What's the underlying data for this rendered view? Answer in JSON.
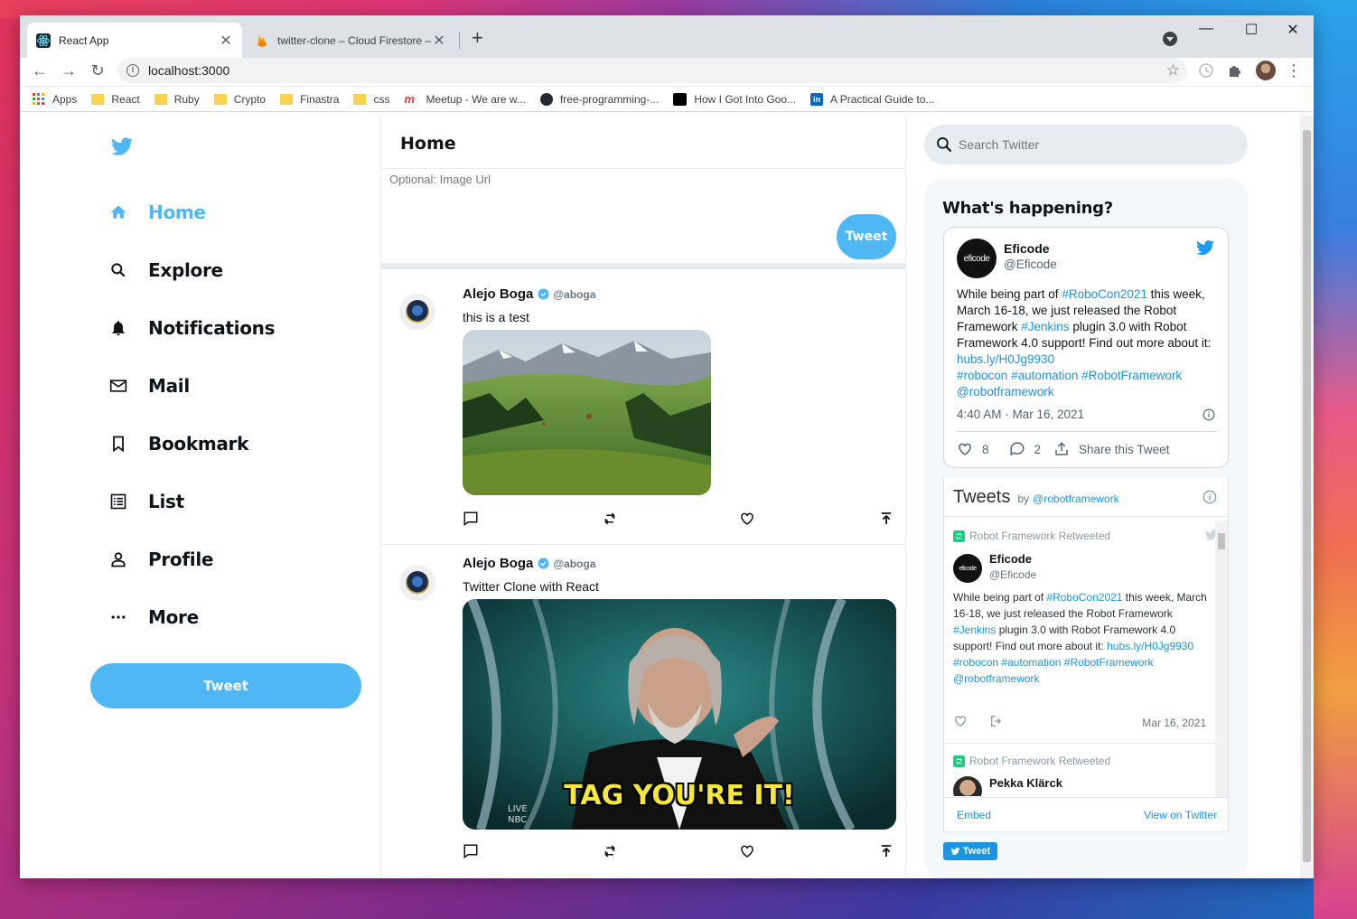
{
  "browser": {
    "tabs": [
      {
        "title": "React App",
        "active": true
      },
      {
        "title": "twitter-clone – Cloud Firestore – ",
        "active": false
      }
    ],
    "url": "localhost:3000",
    "bookmarks": [
      "Apps",
      "React",
      "Ruby",
      "Crypto",
      "Finastra",
      "css",
      "Meetup - We are w...",
      "free-programming-...",
      "How I Got Into Goo...",
      "A Practical Guide to..."
    ]
  },
  "sidebar": {
    "items": [
      {
        "label": "Home",
        "icon": "home-icon",
        "active": true
      },
      {
        "label": "Explore",
        "icon": "search-icon",
        "active": false
      },
      {
        "label": "Notifications",
        "icon": "bell-icon",
        "active": false
      },
      {
        "label": "Mail",
        "icon": "mail-icon",
        "active": false
      },
      {
        "label": "Bookmark",
        "icon": "bookmark-icon",
        "active": false
      },
      {
        "label": "List",
        "icon": "list-icon",
        "active": false
      },
      {
        "label": "Profile",
        "icon": "profile-icon",
        "active": false
      },
      {
        "label": "More",
        "icon": "more-icon",
        "active": false
      }
    ],
    "tweet_button": "Tweet"
  },
  "feed": {
    "title": "Home",
    "composer": {
      "image_placeholder": "Optional: Image Url",
      "tweet_button": "Tweet"
    },
    "posts": [
      {
        "name": "Alejo Boga",
        "handle": "@aboga",
        "text": "this is a test",
        "image": "mountain-landscape"
      },
      {
        "name": "Alejo Boga",
        "handle": "@aboga",
        "text": "Twitter Clone with React",
        "image": "gif",
        "image_caption": "TAG YOU'RE IT!",
        "watermark": "LIVE NBC"
      }
    ]
  },
  "widgets": {
    "search_placeholder": "Search Twitter",
    "title": "What's happening?",
    "embed_tweet": {
      "name": "Eficode",
      "handle": "@Eficode",
      "avatar_text": "eficode",
      "body": {
        "t1": "While being part of ",
        "l1": "#RoboCon2021",
        "t2": " this week, March 16-18, we just released the Robot Framework ",
        "l2": "#Jenkins",
        "t3": " plugin 3.0 with Robot Framework 4.0 support! Find out more about it: ",
        "l3": "hubs.ly/H0Jg9930",
        "l4": "#robocon",
        "l5": "#automation",
        "l6": "#RobotFramework",
        "l7": "@robotframework"
      },
      "time": "4:40 AM · Mar 16, 2021",
      "likes": "8",
      "replies": "2",
      "share": "Share this Tweet"
    },
    "timeline": {
      "title": "Tweets",
      "by": "by",
      "by_handle": "@robotframework",
      "items": [
        {
          "retweet_label": "Robot Framework Retweeted",
          "name": "Eficode",
          "handle": "@Eficode",
          "body": {
            "t1": "While being part of ",
            "l1": "#RoboCon2021",
            "t2": " this week, March 16-18, we just released the Robot Framework ",
            "l2": "#Jenkins",
            "t3": " plugin 3.0 with Robot Framework 4.0 support! Find out more about it: ",
            "l3": "hubs.ly/H0Jg9930",
            "l4": "#robocon",
            "l5": "#automation",
            "l6": "#RobotFramework",
            "l7": "@robotframework"
          },
          "date": "Mar 16, 2021"
        },
        {
          "retweet_label": "Robot Framework Retweeted",
          "name": "Pekka Klärck"
        }
      ],
      "embed_link": "Embed",
      "view_link": "View on Twitter"
    },
    "tweet_badge": "Tweet"
  },
  "colors": {
    "accent": "#50b7f5",
    "link": "#1b95e0",
    "text": "#0f1419",
    "muted": "#657786"
  }
}
